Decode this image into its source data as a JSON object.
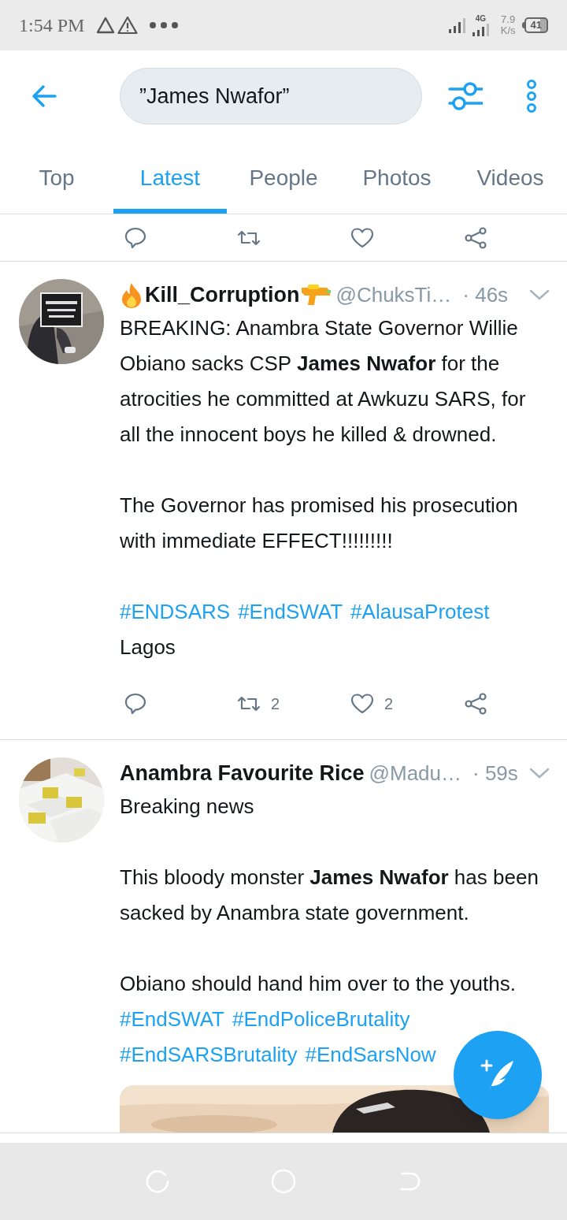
{
  "status_bar": {
    "time": "1:54 PM",
    "network": "4G",
    "speed_value": "7.9",
    "speed_unit": "K/s",
    "battery": "41"
  },
  "search": {
    "query": "”James Nwafor”"
  },
  "tabs": [
    {
      "label": "Top",
      "selected": false
    },
    {
      "label": "Latest",
      "selected": true
    },
    {
      "label": "People",
      "selected": false
    },
    {
      "label": "Photos",
      "selected": false
    },
    {
      "label": "Videos",
      "selected": false
    }
  ],
  "tweets": [
    {
      "name": "Kill_Corruption",
      "name_emoji": true,
      "handle": "@ChuksTi…",
      "time": "· 46s",
      "paragraphs": [
        [
          {
            "kind": "text",
            "text": "BREAKING: Anambra State Governor Willie Obiano sacks CSP **James Nwafor** for the atrocities he committed at Awkuzu SARS, for all the innocent boys he killed & drowned."
          }
        ],
        [
          {
            "kind": "text",
            "text": "The Governor has promised his prosecution with immediate EFFECT!!!!!!!!!"
          }
        ],
        [
          {
            "kind": "hashtags",
            "tags": [
              "#ENDSARS",
              "#EndSWAT",
              "#AlausaProtest"
            ]
          },
          {
            "kind": "text",
            "text": "Lagos"
          }
        ]
      ],
      "retweets": "2",
      "likes": "2",
      "media": false
    },
    {
      "name": "Anambra Favourite Rice",
      "name_emoji": false,
      "handle": "@Madu…",
      "time": "· 59s",
      "paragraphs": [
        [
          {
            "kind": "text",
            "text": "Breaking news"
          }
        ],
        [
          {
            "kind": "text",
            "text": "This bloody monster **James Nwafor** has been sacked by Anambra state government."
          }
        ],
        [
          {
            "kind": "text",
            "text": "Obiano should hand him over to the youths."
          },
          {
            "kind": "hashtags",
            "tags": [
              "#EndSWAT",
              "#EndPoliceBrutality",
              "#EndSARSBrutality",
              "#EndSarsNow"
            ]
          }
        ]
      ],
      "media": true
    }
  ]
}
